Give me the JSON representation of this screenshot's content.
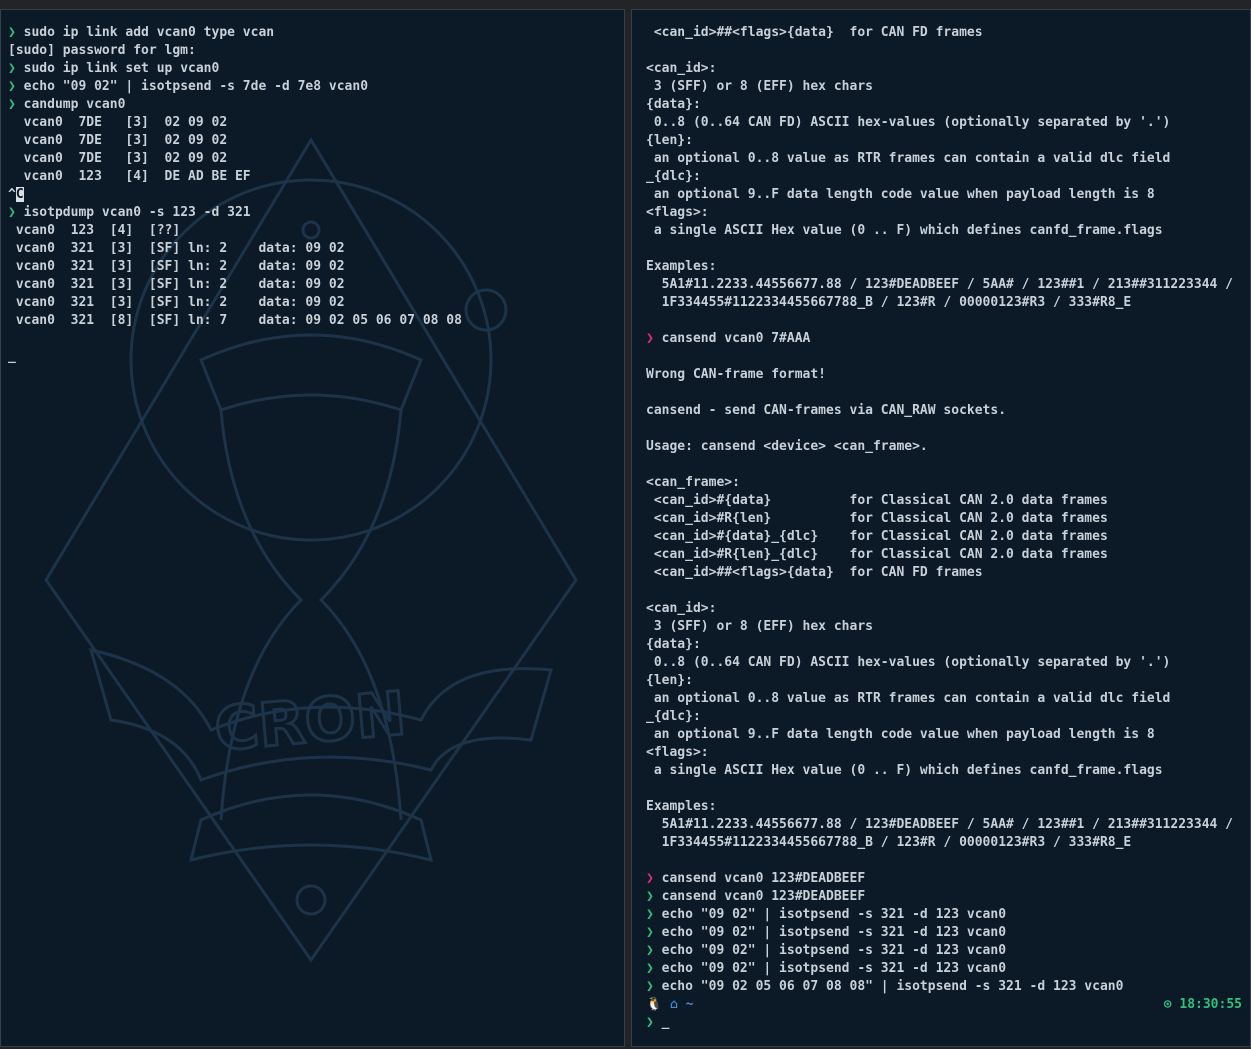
{
  "accent": {
    "prompt_ok": "#2ec27e",
    "prompt_err": "#e0307a",
    "background": "#0c1926"
  },
  "left": {
    "watermark_text": "CRON",
    "lines": [
      {
        "prompt": "❯",
        "text": " sudo ip link add vcan0 type vcan"
      },
      {
        "prompt": "",
        "text": "[sudo] password for lgm:"
      },
      {
        "prompt": "❯",
        "text": " sudo ip link set up vcan0"
      },
      {
        "prompt": "❯",
        "text": " echo \"09 02\" | isotpsend -s 7de -d 7e8 vcan0"
      },
      {
        "prompt": "❯",
        "text": " candump vcan0"
      },
      {
        "prompt": "",
        "text": "  vcan0  7DE   [3]  02 09 02"
      },
      {
        "prompt": "",
        "text": "  vcan0  7DE   [3]  02 09 02"
      },
      {
        "prompt": "",
        "text": "  vcan0  7DE   [3]  02 09 02"
      },
      {
        "prompt": "",
        "text": "  vcan0  123   [4]  DE AD BE EF"
      },
      {
        "prompt": "",
        "text": "^C"
      },
      {
        "prompt": "❯",
        "text": " isotpdump vcan0 -s 123 -d 321"
      },
      {
        "prompt": "",
        "text": " vcan0  123  [4]  [??]"
      },
      {
        "prompt": "",
        "text": " vcan0  321  [3]  [SF] ln: 2    data: 09 02"
      },
      {
        "prompt": "",
        "text": " vcan0  321  [3]  [SF] ln: 2    data: 09 02"
      },
      {
        "prompt": "",
        "text": " vcan0  321  [3]  [SF] ln: 2    data: 09 02"
      },
      {
        "prompt": "",
        "text": " vcan0  321  [3]  [SF] ln: 2    data: 09 02"
      },
      {
        "prompt": "",
        "text": " vcan0  321  [8]  [SF] ln: 7    data: 09 02 05 06 07 08 08"
      },
      {
        "prompt": "",
        "text": ""
      },
      {
        "prompt": "",
        "text": "_"
      }
    ]
  },
  "right": {
    "lines": [
      {
        "prompt": "",
        "text": " <can_id>##<flags>{data}  for CAN FD frames"
      },
      {
        "prompt": "",
        "text": ""
      },
      {
        "prompt": "",
        "text": "<can_id>:"
      },
      {
        "prompt": "",
        "text": " 3 (SFF) or 8 (EFF) hex chars"
      },
      {
        "prompt": "",
        "text": "{data}:"
      },
      {
        "prompt": "",
        "text": " 0..8 (0..64 CAN FD) ASCII hex-values (optionally separated by '.')"
      },
      {
        "prompt": "",
        "text": "{len}:"
      },
      {
        "prompt": "",
        "text": " an optional 0..8 value as RTR frames can contain a valid dlc field"
      },
      {
        "prompt": "",
        "text": "_{dlc}:"
      },
      {
        "prompt": "",
        "text": " an optional 9..F data length code value when payload length is 8"
      },
      {
        "prompt": "",
        "text": "<flags>:"
      },
      {
        "prompt": "",
        "text": " a single ASCII Hex value (0 .. F) which defines canfd_frame.flags"
      },
      {
        "prompt": "",
        "text": ""
      },
      {
        "prompt": "",
        "text": "Examples:"
      },
      {
        "prompt": "",
        "text": "  5A1#11.2233.44556677.88 / 123#DEADBEEF / 5AA# / 123##1 / 213##311223344 /"
      },
      {
        "prompt": "",
        "text": "  1F334455#1122334455667788_B / 123#R / 00000123#R3 / 333#R8_E"
      },
      {
        "prompt": "",
        "text": ""
      },
      {
        "prompt": "❯",
        "prompt_type": "err",
        "text": " cansend vcan0 7#AAA"
      },
      {
        "prompt": "",
        "text": ""
      },
      {
        "prompt": "",
        "text": "Wrong CAN-frame format!"
      },
      {
        "prompt": "",
        "text": ""
      },
      {
        "prompt": "",
        "text": "cansend - send CAN-frames via CAN_RAW sockets."
      },
      {
        "prompt": "",
        "text": ""
      },
      {
        "prompt": "",
        "text": "Usage: cansend <device> <can_frame>."
      },
      {
        "prompt": "",
        "text": ""
      },
      {
        "prompt": "",
        "text": "<can_frame>:"
      },
      {
        "prompt": "",
        "text": " <can_id>#{data}          for Classical CAN 2.0 data frames"
      },
      {
        "prompt": "",
        "text": " <can_id>#R{len}          for Classical CAN 2.0 data frames"
      },
      {
        "prompt": "",
        "text": " <can_id>#{data}_{dlc}    for Classical CAN 2.0 data frames"
      },
      {
        "prompt": "",
        "text": " <can_id>#R{len}_{dlc}    for Classical CAN 2.0 data frames"
      },
      {
        "prompt": "",
        "text": " <can_id>##<flags>{data}  for CAN FD frames"
      },
      {
        "prompt": "",
        "text": ""
      },
      {
        "prompt": "",
        "text": "<can_id>:"
      },
      {
        "prompt": "",
        "text": " 3 (SFF) or 8 (EFF) hex chars"
      },
      {
        "prompt": "",
        "text": "{data}:"
      },
      {
        "prompt": "",
        "text": " 0..8 (0..64 CAN FD) ASCII hex-values (optionally separated by '.')"
      },
      {
        "prompt": "",
        "text": "{len}:"
      },
      {
        "prompt": "",
        "text": " an optional 0..8 value as RTR frames can contain a valid dlc field"
      },
      {
        "prompt": "",
        "text": "_{dlc}:"
      },
      {
        "prompt": "",
        "text": " an optional 9..F data length code value when payload length is 8"
      },
      {
        "prompt": "",
        "text": "<flags>:"
      },
      {
        "prompt": "",
        "text": " a single ASCII Hex value (0 .. F) which defines canfd_frame.flags"
      },
      {
        "prompt": "",
        "text": ""
      },
      {
        "prompt": "",
        "text": "Examples:"
      },
      {
        "prompt": "",
        "text": "  5A1#11.2233.44556677.88 / 123#DEADBEEF / 5AA# / 123##1 / 213##311223344 /"
      },
      {
        "prompt": "",
        "text": "  1F334455#1122334455667788_B / 123#R / 00000123#R3 / 333#R8_E"
      },
      {
        "prompt": "",
        "text": ""
      },
      {
        "prompt": "❯",
        "prompt_type": "err",
        "text": " cansend vcan0 123#DEADBEEF"
      },
      {
        "prompt": "❯",
        "text": " cansend vcan0 123#DEADBEEF"
      },
      {
        "prompt": "❯",
        "text": " echo \"09 02\" | isotpsend -s 321 -d 123 vcan0"
      },
      {
        "prompt": "❯",
        "text": " echo \"09 02\" | isotpsend -s 321 -d 123 vcan0"
      },
      {
        "prompt": "❯",
        "text": " echo \"09 02\" | isotpsend -s 321 -d 123 vcan0"
      },
      {
        "prompt": "❯",
        "text": " echo \"09 02\" | isotpsend -s 321 -d 123 vcan0"
      },
      {
        "prompt": "❯",
        "text": " echo \"09 02 05 06 07 08 08\" | isotpsend -s 321 -d 123 vcan0"
      }
    ],
    "status": {
      "os_icon": "linux-tux-icon",
      "dir_icon": "home-icon",
      "dir": "~",
      "clock_icon": "clock-icon",
      "time": "18:30:55"
    },
    "input": {
      "prompt": "❯",
      "text": " _"
    }
  }
}
